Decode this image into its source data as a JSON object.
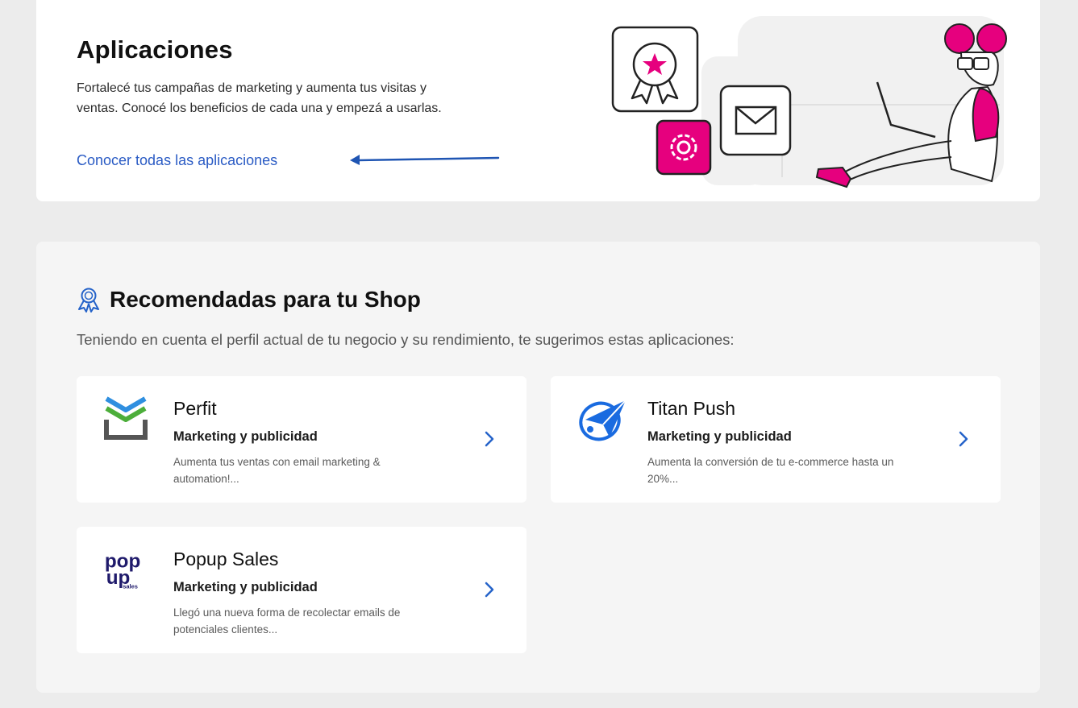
{
  "hero": {
    "title": "Aplicaciones",
    "description": "Fortalecé tus campañas de marketing y aumenta tus visitas y ventas. Conocé los beneficios de cada una y empezá a usarlas.",
    "link_label": "Conocer todas las aplicaciones"
  },
  "recommended": {
    "title": "Recomendadas para tu Shop",
    "subtitle": "Teniendo en cuenta el perfil actual de tu negocio y su rendimiento, te sugerimos estas aplicaciones:",
    "apps": [
      {
        "name": "Perfit",
        "category": "Marketing y publicidad",
        "description": "Aumenta tus ventas con email marketing & automation!...",
        "logo_icon": "perfit-logo-icon"
      },
      {
        "name": "Titan Push",
        "category": "Marketing y publicidad",
        "description": "Aumenta la conversión de tu e-commerce hasta un 20%...",
        "logo_icon": "titan-push-logo-icon"
      },
      {
        "name": "Popup Sales",
        "category": "Marketing y publicidad",
        "description": "Llegó una nueva forma de recolectar emails de potenciales clientes...",
        "logo_icon": "popup-sales-logo-icon",
        "logo_text": {
          "line1": "pop",
          "line2": "up",
          "line3": "sales"
        }
      }
    ]
  },
  "colors": {
    "accent_pink": "#e6007e",
    "link_blue": "#2a5bc4",
    "chevron_blue": "#2563c9",
    "perfit_blue": "#2f8fe0",
    "perfit_green": "#4cae3a",
    "titan_blue": "#1a6be0",
    "popup_navy": "#1f1a6b"
  }
}
